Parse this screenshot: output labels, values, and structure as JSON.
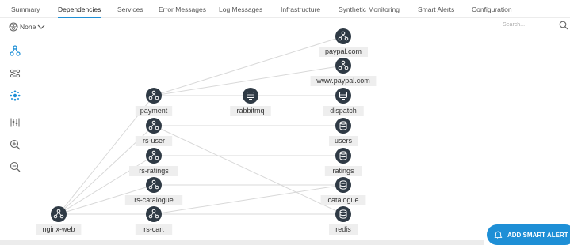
{
  "tabs": [
    {
      "label": "Summary",
      "active": false
    },
    {
      "label": "Dependencies",
      "active": true
    },
    {
      "label": "Services",
      "active": false
    },
    {
      "label": "Error Messages",
      "active": false
    },
    {
      "label": "Log Messages",
      "active": false
    },
    {
      "label": "Infrastructure",
      "active": false
    },
    {
      "label": "Synthetic Monitoring",
      "active": false
    },
    {
      "label": "Smart Alerts",
      "active": false
    },
    {
      "label": "Configuration",
      "active": false
    }
  ],
  "search": {
    "placeholder": "Search..."
  },
  "group_select": {
    "label": "None"
  },
  "toolbar": [
    {
      "name": "hierarchy-layout-icon"
    },
    {
      "name": "connections-layout-icon"
    },
    {
      "name": "cluster-layout-icon"
    },
    {
      "name": "filter-layout-icon"
    },
    {
      "name": "zoom-in-icon"
    },
    {
      "name": "zoom-out-icon"
    }
  ],
  "graph": {
    "nodes": [
      {
        "id": "paypal-com",
        "label": "paypal.com",
        "kind": "service"
      },
      {
        "id": "www-paypal-com",
        "label": "www.paypal.com",
        "kind": "service"
      },
      {
        "id": "payment",
        "label": "payment",
        "kind": "service"
      },
      {
        "id": "rabbitmq",
        "label": "rabbitmq",
        "kind": "queue"
      },
      {
        "id": "dispatch",
        "label": "dispatch",
        "kind": "queue"
      },
      {
        "id": "rs-user",
        "label": "rs-user",
        "kind": "service"
      },
      {
        "id": "users",
        "label": "users",
        "kind": "database"
      },
      {
        "id": "rs-ratings",
        "label": "rs-ratings",
        "kind": "service"
      },
      {
        "id": "ratings",
        "label": "ratings",
        "kind": "database"
      },
      {
        "id": "rs-catalogue",
        "label": "rs-catalogue",
        "kind": "service"
      },
      {
        "id": "catalogue",
        "label": "catalogue",
        "kind": "database"
      },
      {
        "id": "nginx-web",
        "label": "nginx-web",
        "kind": "service"
      },
      {
        "id": "rs-cart",
        "label": "rs-cart",
        "kind": "service"
      },
      {
        "id": "redis",
        "label": "redis",
        "kind": "database"
      }
    ],
    "edges": [
      [
        "nginx-web",
        "payment"
      ],
      [
        "nginx-web",
        "rs-user"
      ],
      [
        "nginx-web",
        "rs-ratings"
      ],
      [
        "nginx-web",
        "rs-catalogue"
      ],
      [
        "nginx-web",
        "rs-cart"
      ],
      [
        "payment",
        "paypal-com"
      ],
      [
        "payment",
        "www-paypal-com"
      ],
      [
        "payment",
        "dispatch"
      ],
      [
        "rs-user",
        "users"
      ],
      [
        "rs-user",
        "redis"
      ],
      [
        "rs-ratings",
        "ratings"
      ],
      [
        "rs-catalogue",
        "catalogue"
      ],
      [
        "rs-cart",
        "redis"
      ],
      [
        "rs-cart",
        "catalogue"
      ]
    ]
  },
  "cta": {
    "label": "ADD SMART ALERT"
  },
  "colors": {
    "accent": "#1e8fd6",
    "node": "#2f3a45",
    "edge": "#d8d8d8"
  }
}
